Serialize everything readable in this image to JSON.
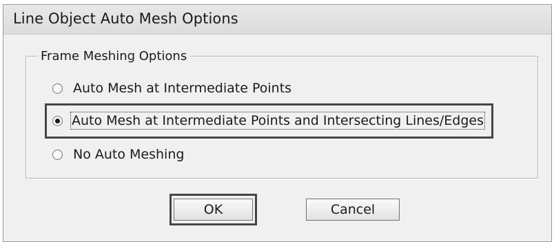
{
  "window": {
    "title": "Line Object Auto Mesh Options"
  },
  "frame_meshing": {
    "group_label": "Frame Meshing Options",
    "options": [
      {
        "label": "Auto Mesh at Intermediate Points",
        "checked": false
      },
      {
        "label": "Auto Mesh at Intermediate Points and Intersecting Lines/Edges",
        "checked": true
      },
      {
        "label": "No Auto Meshing",
        "checked": false
      }
    ]
  },
  "buttons": {
    "ok_label": "OK",
    "cancel_label": "Cancel"
  }
}
